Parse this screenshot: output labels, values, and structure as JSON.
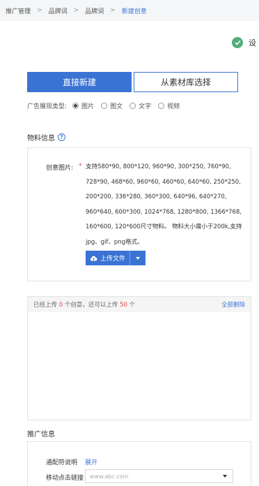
{
  "breadcrumb": {
    "items": [
      "推广管理",
      "品牌词",
      "品牌词",
      "新建创意"
    ],
    "separator": ">"
  },
  "status": {
    "text": "设",
    "icon": "check-circle-icon",
    "color": "#52ad7d"
  },
  "tabs": [
    {
      "label": "直接新建",
      "active": true
    },
    {
      "label": "从素材库选择",
      "active": false
    }
  ],
  "ad_type": {
    "label": "广告展现类型:",
    "options": [
      "图片",
      "图文",
      "文字",
      "视频"
    ],
    "selected": "图片"
  },
  "material": {
    "title": "物料信息",
    "creative_label": "创意图片:",
    "required_mark": "*",
    "description": "支持580*90, 800*120, 960*90, 300*250, 760*90, 728*90, 468*60, 960*60, 460*60, 640*60, 250*250, 200*200, 336*280, 360*300, 640*96, 640*270, 960*640, 600*300, 1024*768, 1280*800, 1366*768, 160*600, 120*600尺寸物料。 物料大小需小于200k,支持jpg、gif、png格式。",
    "upload_label": "上传文件"
  },
  "upload_list": {
    "prefix": "已经上传",
    "uploaded": "0",
    "middle": "个创意，还可以上传",
    "remaining": "50",
    "suffix": "个",
    "delete_all": "全部删除"
  },
  "promotion": {
    "title": "推广信息",
    "wildcard_label": "通配符说明",
    "expand_label": "展开",
    "mobile_link_label": "移动点击链接",
    "url_placeholder": "www.abc.com"
  },
  "colors": {
    "accent": "#3a73d4",
    "link": "#3d7ad8",
    "number_red": "#e04545",
    "success": "#52ad7d"
  }
}
